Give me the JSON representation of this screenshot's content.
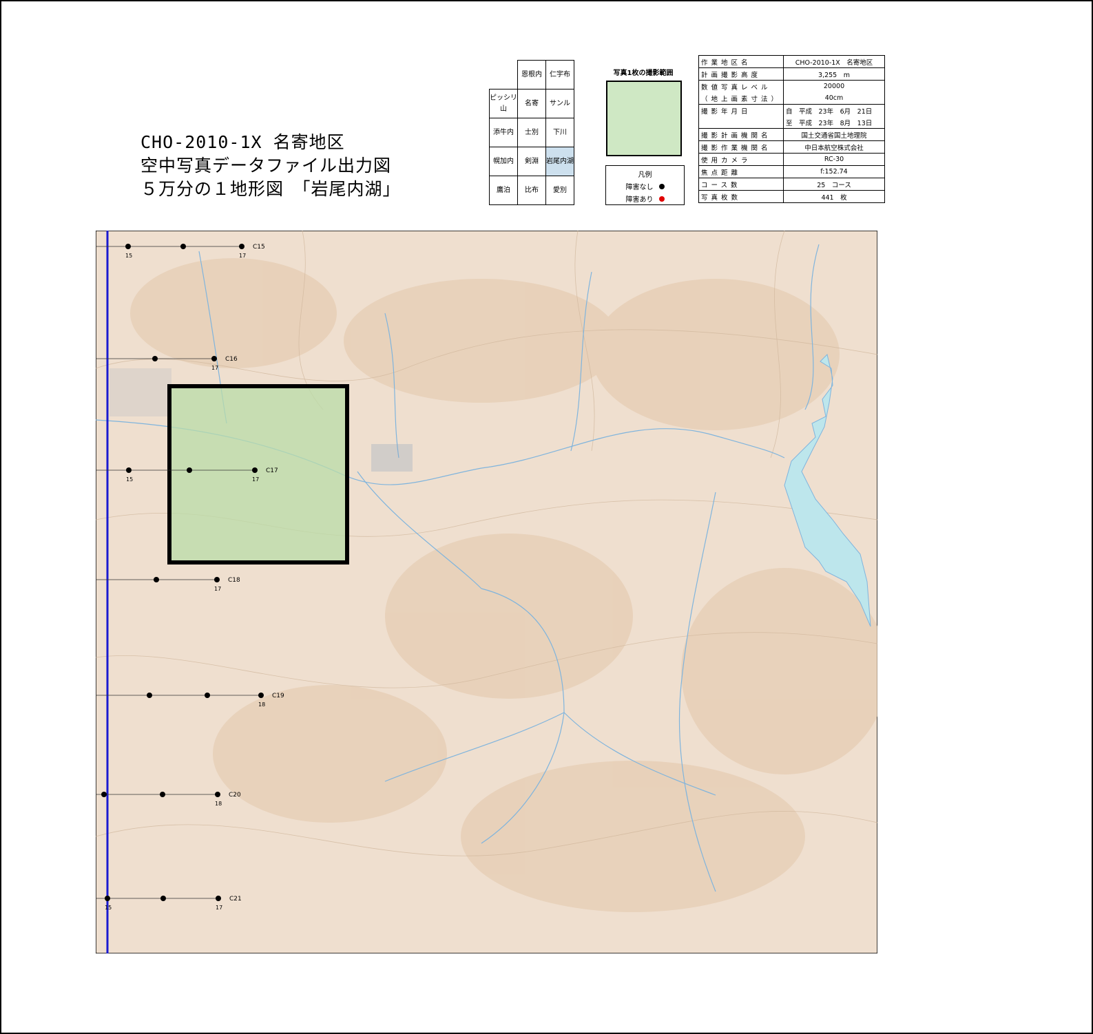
{
  "title": {
    "line1": "CHO-2010-1X 名寄地区",
    "line2": "空中写真データファイル出力図",
    "line3": "５万分の１地形図　「岩尾内湖」"
  },
  "index_grid": [
    [
      "",
      "恩根内",
      "仁宇布"
    ],
    [
      "ピッシリ山",
      "名寄",
      "サンル"
    ],
    [
      "添牛内",
      "士別",
      "下川"
    ],
    [
      "幌加内",
      "剣淵",
      "岩尾内湖"
    ],
    [
      "鷹泊",
      "比布",
      "愛別"
    ]
  ],
  "coverage": {
    "label": "写真1枚の撮影範囲"
  },
  "legend": {
    "title": "凡例",
    "no_obstacle": "障害なし",
    "obstacle": "障害あり",
    "no_obstacle_color": "#000000",
    "obstacle_color": "#e00000"
  },
  "info": [
    {
      "k": "作業地区名",
      "v": "CHO-2010-1X　名寄地区"
    },
    {
      "k": "計画撮影高度",
      "v": "3,255　m"
    },
    {
      "k": "数値写真レベル",
      "v": "20000"
    },
    {
      "k": "（地上画素寸法）",
      "v": "40cm"
    },
    {
      "k": "撮影年月日",
      "v": "自　平成　23年　6月　21日"
    },
    {
      "k": "",
      "v": "至　平成　23年　8月　13日"
    },
    {
      "k": "撮影計画機関名",
      "v": "国土交通省国土地理院"
    },
    {
      "k": "撮影作業機関名",
      "v": "中日本航空株式会社"
    },
    {
      "k": "使用カメラ",
      "v": "RC-30"
    },
    {
      "k": "焦点距離",
      "v": "f:152.74"
    },
    {
      "k": "コース数",
      "v": "25　コース"
    },
    {
      "k": "写真枚数",
      "v": "441　枚"
    }
  ],
  "map": {
    "courses": [
      {
        "name": "C15",
        "start": "15",
        "end": "17"
      },
      {
        "name": "C16",
        "start": "",
        "end": "17"
      },
      {
        "name": "C17",
        "start": "15",
        "end": "17"
      },
      {
        "name": "C18",
        "start": "",
        "end": "17"
      },
      {
        "name": "C19",
        "start": "",
        "end": "18"
      },
      {
        "name": "C20",
        "start": "",
        "end": "18"
      },
      {
        "name": "C21",
        "start": "15",
        "end": "17"
      }
    ],
    "colors": {
      "terrain": "#efdfcf",
      "water": "#bde6ec",
      "flightline": "#1a1ad0",
      "coverage": "#b9dca8"
    }
  }
}
